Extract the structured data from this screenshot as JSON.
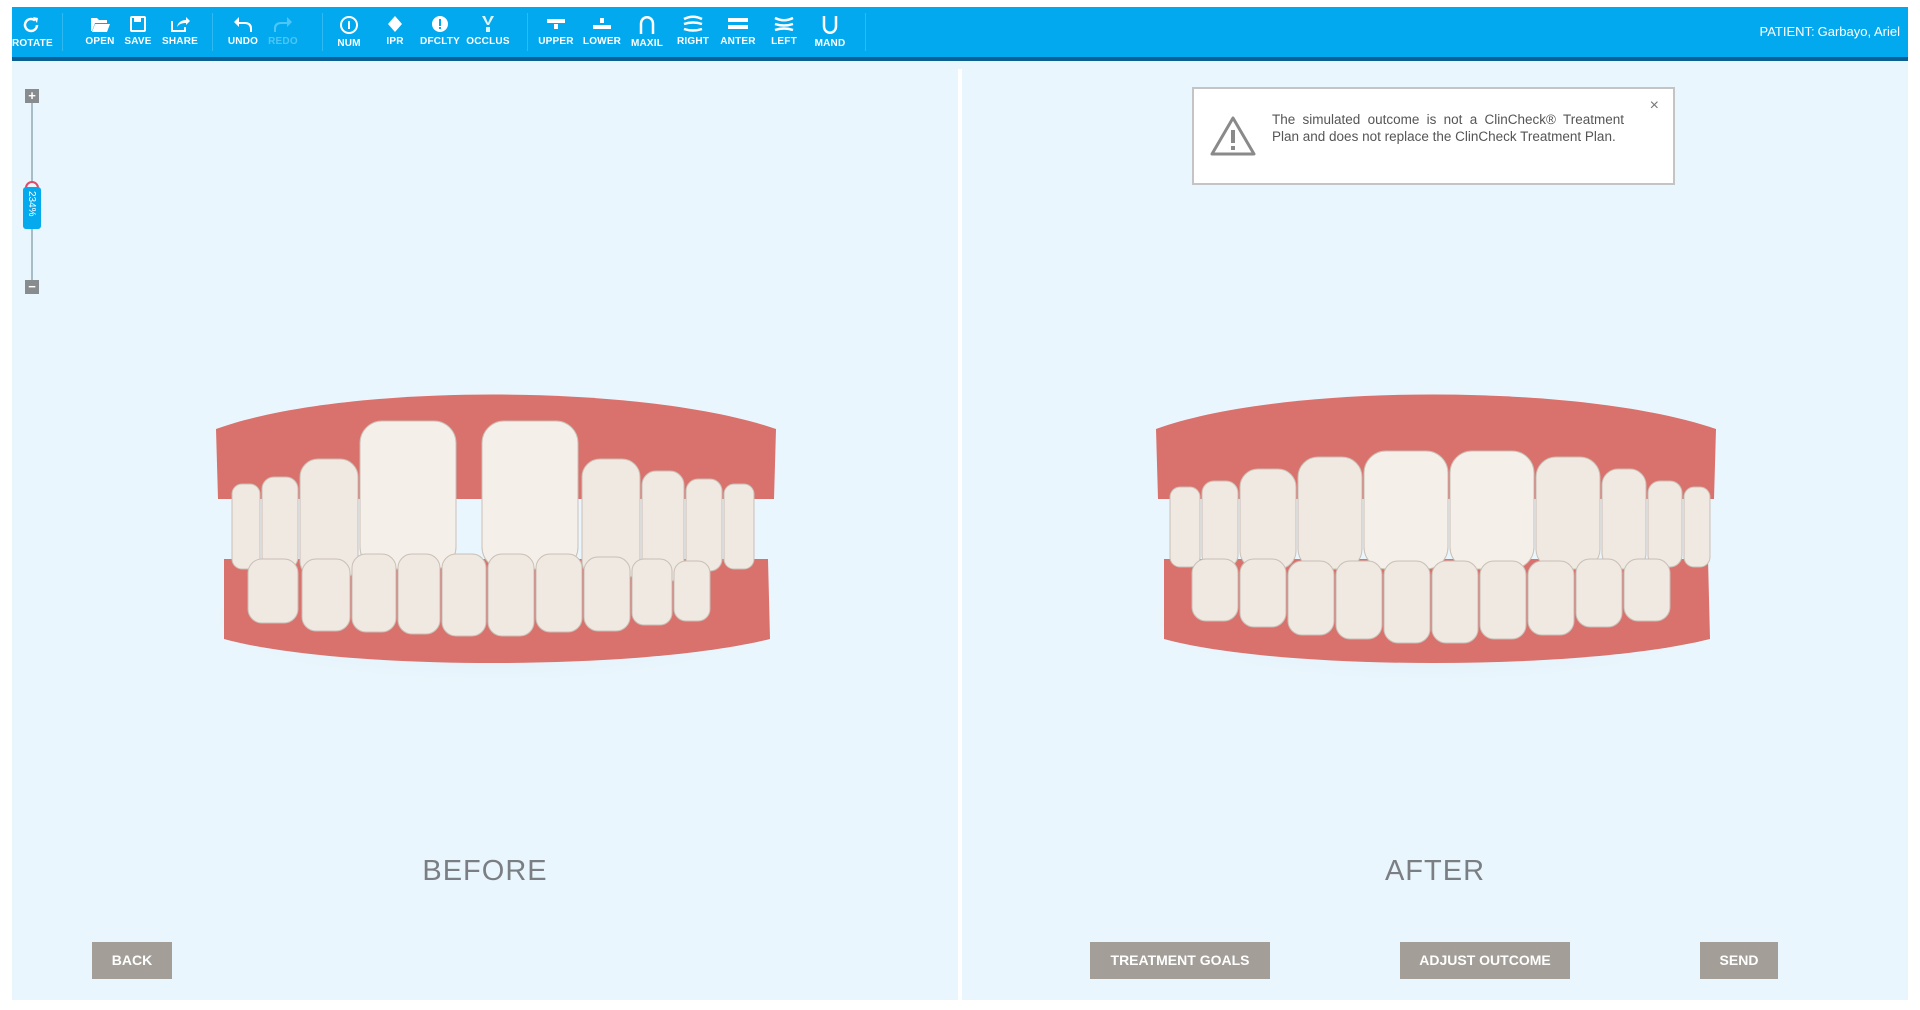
{
  "toolbar": {
    "buttons": [
      {
        "label": "ROTATE",
        "icon": "rotate-icon"
      },
      {
        "label": "OPEN",
        "icon": "folder-open-icon"
      },
      {
        "label": "SAVE",
        "icon": "save-icon"
      },
      {
        "label": "SHARE",
        "icon": "share-icon"
      },
      {
        "label": "UNDO",
        "icon": "undo-icon"
      },
      {
        "label": "REDO",
        "icon": "redo-icon",
        "disabled": true
      },
      {
        "label": "NUM",
        "icon": "number-icon"
      },
      {
        "label": "IPR",
        "icon": "diamond-icon"
      },
      {
        "label": "DFCLTY",
        "icon": "exclamation-icon"
      },
      {
        "label": "OCCLUS",
        "icon": "occlusion-icon"
      },
      {
        "label": "UPPER",
        "icon": "upper-jaw-icon"
      },
      {
        "label": "LOWER",
        "icon": "lower-jaw-icon"
      },
      {
        "label": "MAXIL",
        "icon": "maxillary-arch-icon"
      },
      {
        "label": "RIGHT",
        "icon": "right-view-icon"
      },
      {
        "label": "ANTER",
        "icon": "anterior-view-icon"
      },
      {
        "label": "LEFT",
        "icon": "left-view-icon"
      },
      {
        "label": "MAND",
        "icon": "mandibular-arch-icon"
      }
    ],
    "patient_label": "PATIENT:",
    "patient_name": "Garbayo, Ariel"
  },
  "zoom": {
    "plus": "+",
    "minus": "−",
    "value": "234%"
  },
  "notice": {
    "text": "The simulated outcome is not a ClinCheck® Treatment Plan and does not replace the ClinCheck Treatment Plan.",
    "close": "×"
  },
  "left_panel": {
    "caption": "BEFORE",
    "back_button": "BACK"
  },
  "right_panel": {
    "caption": "AFTER",
    "treatment_goals_button": "TREATMENT GOALS",
    "adjust_outcome_button": "ADJUST OUTCOME",
    "send_button": "SEND"
  },
  "colors": {
    "toolbar": "#03a9ee",
    "toolbar_border": "#0a5f95",
    "panel_bg": "#eaf6fd",
    "button_gray": "#a39e98",
    "gum": "#d9716c",
    "tooth": "#f1ece6"
  }
}
